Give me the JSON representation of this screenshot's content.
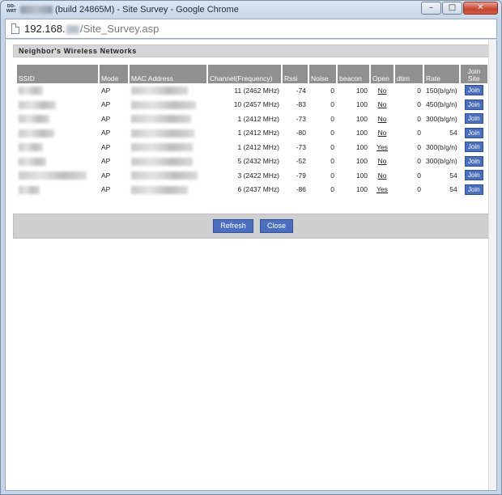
{
  "window": {
    "app_icon_label": "DD-WRT",
    "title": "(build 24865M) - Site Survey - Google Chrome",
    "minimize_glyph": "–",
    "maximize_glyph": "□",
    "close_glyph": "✕"
  },
  "address": {
    "host": "192.168.",
    "path": "/Site_Survey.asp"
  },
  "section": {
    "title": "Neighbor's Wireless Networks"
  },
  "table": {
    "headers": {
      "ssid": "SSID",
      "mode": "Mode",
      "mac": "MAC Address",
      "channel": "Channel(Frequency)",
      "rssi": "Rssi",
      "noise": "Noise",
      "beacon": "beacon",
      "open": "Open",
      "dtim": "dtim",
      "rate": "Rate",
      "join": "Join Site"
    },
    "rows": [
      {
        "mode": "AP",
        "channel": "11 (2462 MHz)",
        "rssi": "-74",
        "noise": "0",
        "beacon": "100",
        "open": "No",
        "dtim": "0",
        "rate": "150(b/g/n)",
        "join": "Join"
      },
      {
        "mode": "AP",
        "channel": "10 (2457 MHz)",
        "rssi": "-83",
        "noise": "0",
        "beacon": "100",
        "open": "No",
        "dtim": "0",
        "rate": "450(b/g/n)",
        "join": "Join"
      },
      {
        "mode": "AP",
        "channel": "1 (2412 MHz)",
        "rssi": "-73",
        "noise": "0",
        "beacon": "100",
        "open": "No",
        "dtim": "0",
        "rate": "300(b/g/n)",
        "join": "Join"
      },
      {
        "mode": "AP",
        "channel": "1 (2412 MHz)",
        "rssi": "-80",
        "noise": "0",
        "beacon": "100",
        "open": "No",
        "dtim": "0",
        "rate": "54",
        "join": "Join"
      },
      {
        "mode": "AP",
        "channel": "1 (2412 MHz)",
        "rssi": "-73",
        "noise": "0",
        "beacon": "100",
        "open": "Yes",
        "dtim": "0",
        "rate": "300(b/g/n)",
        "join": "Join"
      },
      {
        "mode": "AP",
        "channel": "5 (2432 MHz)",
        "rssi": "-52",
        "noise": "0",
        "beacon": "100",
        "open": "No",
        "dtim": "0",
        "rate": "300(b/g/n)",
        "join": "Join"
      },
      {
        "mode": "AP",
        "channel": "3 (2422 MHz)",
        "rssi": "-79",
        "noise": "0",
        "beacon": "100",
        "open": "No",
        "dtim": "0",
        "rate": "54",
        "join": "Join"
      },
      {
        "mode": "AP",
        "channel": "6 (2437 MHz)",
        "rssi": "-86",
        "noise": "0",
        "beacon": "100",
        "open": "Yes",
        "dtim": "0",
        "rate": "54",
        "join": "Join"
      }
    ]
  },
  "buttons": {
    "refresh": "Refresh",
    "close": "Close"
  },
  "colors": {
    "button_blue": "#4a6fc0",
    "header_gray": "#909090",
    "bar_gray": "#cfcfcf"
  }
}
